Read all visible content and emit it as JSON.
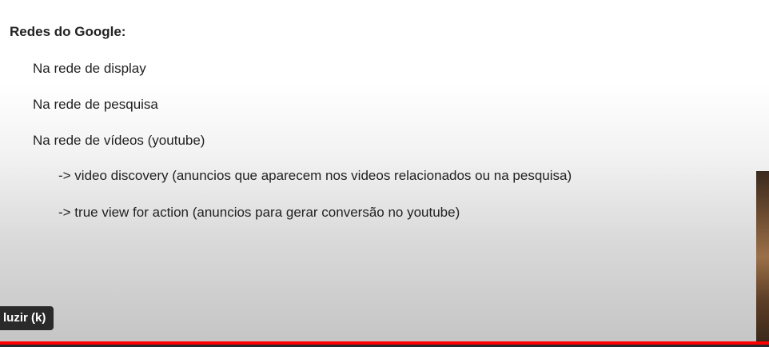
{
  "slide": {
    "heading": "Redes do Google:",
    "items": [
      {
        "text": "Na rede de display"
      },
      {
        "text": "Na rede de pesquisa"
      },
      {
        "text": "Na rede de vídeos (youtube)"
      },
      {
        "text": "-> video discovery (anuncios que aparecem nos videos relacionados ou na pesquisa)"
      },
      {
        "text": "-> true view for action (anuncios para gerar conversão no youtube)"
      }
    ]
  },
  "player": {
    "tooltip": "luzir (k)",
    "progress_fraction": 1.0,
    "progress_color": "#ff0000"
  }
}
